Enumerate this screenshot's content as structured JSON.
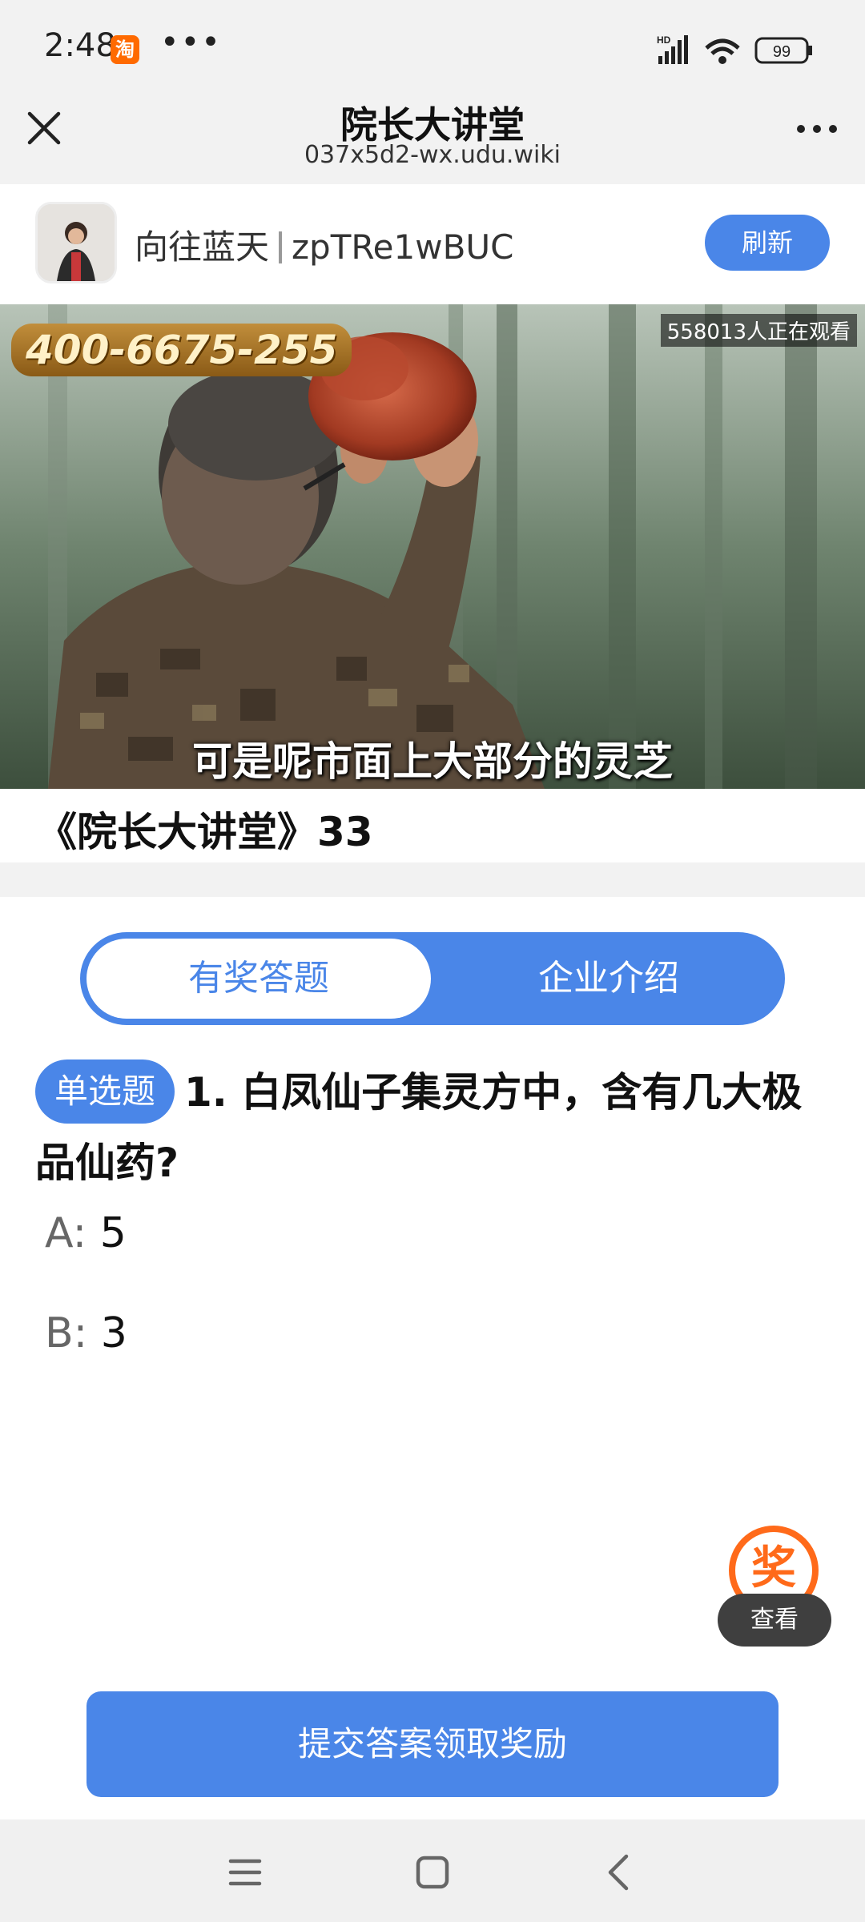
{
  "status_bar": {
    "time": "2:48",
    "app_badge": "淘",
    "more_dots": "•••",
    "battery": "99"
  },
  "header": {
    "title": "院长大讲堂",
    "url": "037x5d2-wx.udu.wiki"
  },
  "channel": {
    "name": "向往蓝天",
    "id": "zpTRe1wBUC",
    "refresh_label": "刷新"
  },
  "video": {
    "phone_overlay": "400-6675-255",
    "viewers": "558013人正在观看",
    "subtitle": "可是呢市面上大部分的灵芝"
  },
  "video_title": "《院长大讲堂》33",
  "tabs": [
    {
      "label": "有奖答题",
      "active": true
    },
    {
      "label": "企业介绍",
      "active": false
    }
  ],
  "question": {
    "type": "单选题",
    "text": "1. 白凤仙子集灵方中，含有几大极品仙药?",
    "options": [
      {
        "key": "A:",
        "value": "5"
      },
      {
        "key": "B:",
        "value": "3"
      }
    ]
  },
  "reward": {
    "icon_text": "奖",
    "view_label": "查看"
  },
  "submit_label": "提交答案领取奖励",
  "colors": {
    "primary": "#4a86e8",
    "reward": "#ff6a1a",
    "taobao": "#ff6a00"
  }
}
